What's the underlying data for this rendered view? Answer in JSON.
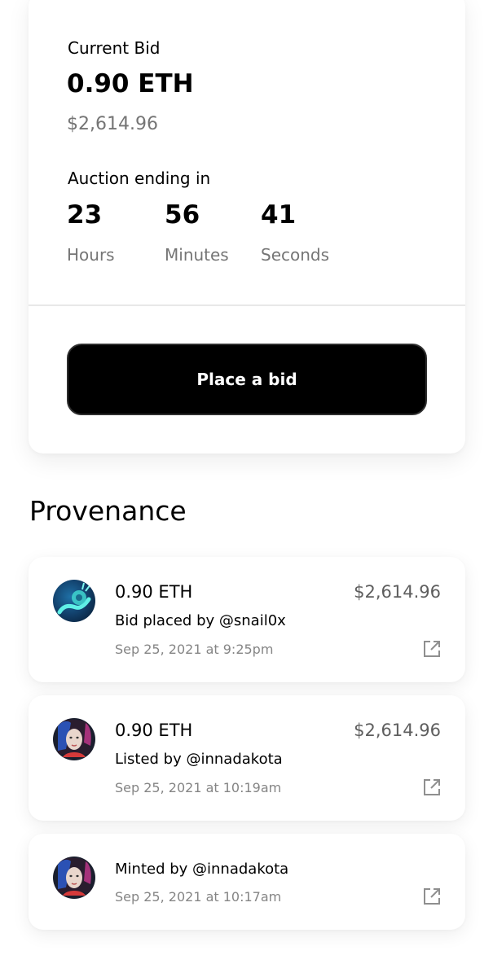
{
  "auction": {
    "current_bid_label": "Current Bid",
    "current_bid_eth": "0.90 ETH",
    "current_bid_usd": "$2,614.96",
    "ending_label": "Auction ending in",
    "countdown": {
      "hours": "23",
      "hours_label": "Hours",
      "minutes": "56",
      "minutes_label": "Minutes",
      "seconds": "41",
      "seconds_label": "Seconds"
    },
    "place_bid_label": "Place a bid"
  },
  "provenance": {
    "title": "Provenance",
    "items": [
      {
        "eth": "0.90 ETH",
        "usd": "$2,614.96",
        "by": "Bid placed by @snail0x",
        "date": "Sep 25, 2021 at 9:25pm",
        "avatar": "snail-avatar",
        "icon": "external-link-icon"
      },
      {
        "eth": "0.90 ETH",
        "usd": "$2,614.96",
        "by": "Listed by @innadakota",
        "date": "Sep 25, 2021 at 10:19am",
        "avatar": "portrait-avatar",
        "icon": "external-link-icon"
      },
      {
        "by": "Minted by @innadakota",
        "date": "Sep 25, 2021 at 10:17am",
        "avatar": "portrait-avatar",
        "icon": "external-link-icon"
      }
    ]
  },
  "colors": {
    "button_bg": "#000000",
    "muted_text": "#757575",
    "card_bg": "#ffffff"
  }
}
